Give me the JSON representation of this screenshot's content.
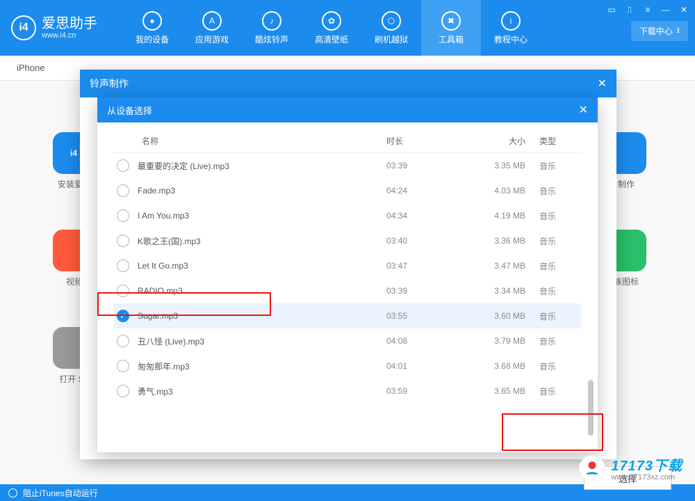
{
  "brand": {
    "name": "爱思助手",
    "url": "www.i4.cn",
    "mark": "i4"
  },
  "window": {
    "download_center": "下载中心"
  },
  "nav": [
    {
      "label": "我的设备"
    },
    {
      "label": "应用游戏"
    },
    {
      "label": "酷炫铃声"
    },
    {
      "label": "高清壁纸"
    },
    {
      "label": "刷机越狱"
    },
    {
      "label": "工具箱",
      "active": true
    },
    {
      "label": "教程中心"
    }
  ],
  "tab": "iPhone",
  "tiles": [
    {
      "label": "安装爱思",
      "color": "#1b8bed"
    },
    {
      "label": "制作",
      "color": "#1b8bed"
    },
    {
      "label": "视频",
      "color": "#ff5a3c"
    },
    {
      "label": "族图标",
      "color": "#28c06a"
    },
    {
      "label": "打开 SS",
      "color": "#9a9a9a"
    }
  ],
  "modal_outer": {
    "title": "铃声制作"
  },
  "modal_inner": {
    "title": "从设备选择",
    "columns": {
      "name": "名称",
      "duration": "时长",
      "size": "大小",
      "type": "类型"
    },
    "select_button": "选择",
    "rows": [
      {
        "name": "最重要的决定 (Live).mp3",
        "dur": "03:39",
        "size": "3.35 MB",
        "type": "音乐"
      },
      {
        "name": "Fade.mp3",
        "dur": "04:24",
        "size": "4.03 MB",
        "type": "音乐"
      },
      {
        "name": "I Am You.mp3",
        "dur": "04:34",
        "size": "4.19 MB",
        "type": "音乐"
      },
      {
        "name": "K歌之王(国).mp3",
        "dur": "03:40",
        "size": "3.36 MB",
        "type": "音乐"
      },
      {
        "name": "Let It Go.mp3",
        "dur": "03:47",
        "size": "3.47 MB",
        "type": "音乐"
      },
      {
        "name": "RADIO.mp3",
        "dur": "03:39",
        "size": "3.34 MB",
        "type": "音乐"
      },
      {
        "name": "Sugar.mp3",
        "dur": "03:55",
        "size": "3.60 MB",
        "type": "音乐",
        "selected": true
      },
      {
        "name": "丑八怪 (Live).mp3",
        "dur": "04:08",
        "size": "3.79 MB",
        "type": "音乐"
      },
      {
        "name": "匆匆那年.mp3",
        "dur": "04:01",
        "size": "3.68 MB",
        "type": "音乐"
      },
      {
        "name": "勇气.mp3",
        "dur": "03:59",
        "size": "3.65 MB",
        "type": "音乐"
      }
    ]
  },
  "status": "阻止iTunes自动运行",
  "wm": {
    "title": "17173下载",
    "sub": "www.17173xz.com"
  }
}
